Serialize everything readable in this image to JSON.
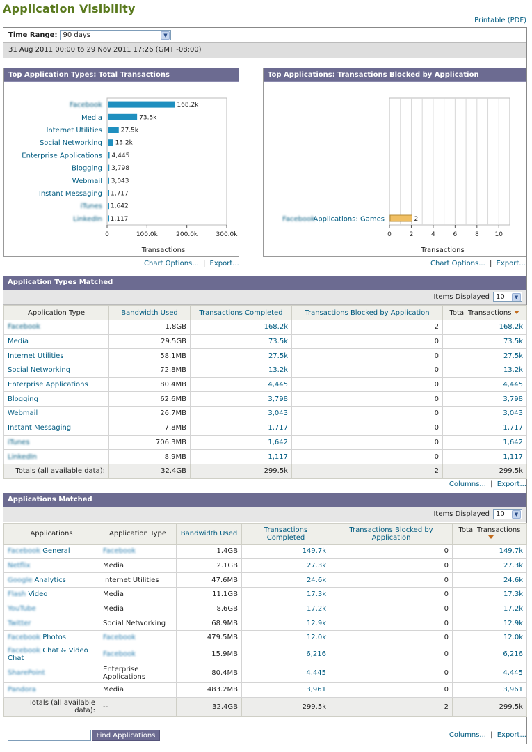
{
  "page": {
    "title": "Application Visibility",
    "printable": "Printable (PDF)"
  },
  "timerange": {
    "label": "Time Range:",
    "value": "90 days",
    "range_text": "31 Aug 2011 00:00 to 29 Nov 2011 17:26 (GMT -08:00)"
  },
  "chart_links": {
    "options": "Chart Options...",
    "sep": "|",
    "export": "Export..."
  },
  "chart_data": [
    {
      "type": "bar",
      "title": "Top Application Types: Total Transactions",
      "xlabel": "Transactions",
      "categories": [
        "Facebook",
        "Media",
        "Internet Utilities",
        "Social Networking",
        "Enterprise Applications",
        "Blogging",
        "Webmail",
        "Instant Messaging",
        "iTunes",
        "LinkedIn"
      ],
      "values": [
        168200,
        73500,
        27500,
        13200,
        4445,
        3798,
        3043,
        1717,
        1642,
        1117
      ],
      "value_labels": [
        "168.2k",
        "73.5k",
        "27.5k",
        "13.2k",
        "4,445",
        "3,798",
        "3,043",
        "1,717",
        "1,642",
        "1,117"
      ],
      "xlim": [
        0,
        300000
      ],
      "ticks": [
        0,
        100000,
        200000,
        300000
      ],
      "tick_labels": [
        "0",
        "100.0k",
        "200.0k",
        "300.0k"
      ],
      "orientation": "horizontal",
      "bar_color": "#1f8fbf",
      "grid": false
    },
    {
      "type": "bar",
      "title": "Top Applications: Transactions Blocked by Application",
      "xlabel": "Transactions",
      "categories": [
        "Facebook Applications: Games"
      ],
      "category_prefix": "Facebook",
      "category_suffix": "Applications: Games",
      "values": [
        2
      ],
      "value_labels": [
        "2"
      ],
      "xlim": [
        0,
        11
      ],
      "ticks": [
        0,
        2,
        4,
        6,
        8,
        10
      ],
      "tick_labels": [
        "0",
        "2",
        "4",
        "6",
        "8",
        "10"
      ],
      "orientation": "horizontal",
      "bar_color": "#f0bf63",
      "grid": true
    }
  ],
  "types_section": {
    "title": "Application Types Matched",
    "items_label": "Items Displayed",
    "items_value": "10",
    "columns": [
      "Application Type",
      "Bandwidth Used",
      "Transactions Completed",
      "Transactions Blocked by Application",
      "Total Transactions"
    ],
    "rows": [
      [
        "Facebook",
        "1.8GB",
        "168.2k",
        "2",
        "168.2k"
      ],
      [
        "Media",
        "29.5GB",
        "73.5k",
        "0",
        "73.5k"
      ],
      [
        "Internet Utilities",
        "58.1MB",
        "27.5k",
        "0",
        "27.5k"
      ],
      [
        "Social Networking",
        "72.8MB",
        "13.2k",
        "0",
        "13.2k"
      ],
      [
        "Enterprise Applications",
        "80.4MB",
        "4,445",
        "0",
        "4,445"
      ],
      [
        "Blogging",
        "62.6MB",
        "3,798",
        "0",
        "3,798"
      ],
      [
        "Webmail",
        "26.7MB",
        "3,043",
        "0",
        "3,043"
      ],
      [
        "Instant Messaging",
        "7.8MB",
        "1,717",
        "0",
        "1,717"
      ],
      [
        "iTunes",
        "706.3MB",
        "1,642",
        "0",
        "1,642"
      ],
      [
        "LinkedIn",
        "8.9MB",
        "1,117",
        "0",
        "1,117"
      ]
    ],
    "totals": [
      "Totals (all available data):",
      "32.4GB",
      "299.5k",
      "2",
      "299.5k"
    ],
    "links": {
      "columns": "Columns...",
      "sep": "|",
      "export": "Export..."
    }
  },
  "apps_section": {
    "title": "Applications Matched",
    "items_label": "Items Displayed",
    "items_value": "10",
    "columns": [
      "Applications",
      "Application Type",
      "Bandwidth Used",
      "Transactions Completed",
      "Transactions Blocked by Application",
      "Total Transactions"
    ],
    "rows": [
      {
        "pre": "Facebook",
        "name": "General",
        "type": "Facebook",
        "type_blur": true,
        "bw": "1.4GB",
        "tc": "149.7k",
        "tb": "0",
        "tt": "149.7k"
      },
      {
        "pre": "Netflix",
        "name": "",
        "type": "Media",
        "type_blur": false,
        "bw": "2.1GB",
        "tc": "27.3k",
        "tb": "0",
        "tt": "27.3k"
      },
      {
        "pre": "Google",
        "name": "Analytics",
        "type": "Internet Utilities",
        "type_blur": false,
        "bw": "47.6MB",
        "tc": "24.6k",
        "tb": "0",
        "tt": "24.6k"
      },
      {
        "pre": "Flash",
        "name": "Video",
        "type": "Media",
        "type_blur": false,
        "bw": "11.1GB",
        "tc": "17.3k",
        "tb": "0",
        "tt": "17.3k"
      },
      {
        "pre": "YouTube",
        "name": "",
        "type": "Media",
        "type_blur": false,
        "bw": "8.6GB",
        "tc": "17.2k",
        "tb": "0",
        "tt": "17.2k"
      },
      {
        "pre": "Twitter",
        "name": "",
        "type": "Social Networking",
        "type_blur": false,
        "bw": "68.9MB",
        "tc": "12.9k",
        "tb": "0",
        "tt": "12.9k"
      },
      {
        "pre": "Facebook",
        "name": "Photos",
        "type": "Facebook",
        "type_blur": true,
        "bw": "479.5MB",
        "tc": "12.0k",
        "tb": "0",
        "tt": "12.0k"
      },
      {
        "pre": "Facebook",
        "name": "Chat & Video Chat",
        "type": "Facebook",
        "type_blur": true,
        "bw": "15.9MB",
        "tc": "6,216",
        "tb": "0",
        "tt": "6,216"
      },
      {
        "pre": "SharePoint",
        "name": "",
        "type": "Enterprise Applications",
        "type_blur": false,
        "bw": "80.4MB",
        "tc": "4,445",
        "tb": "0",
        "tt": "4,445"
      },
      {
        "pre": "Pandora",
        "name": "",
        "type": "Media",
        "type_blur": false,
        "bw": "483.2MB",
        "tc": "3,961",
        "tb": "0",
        "tt": "3,961"
      }
    ],
    "totals": [
      "Totals (all available data):",
      "--",
      "32.4GB",
      "299.5k",
      "2",
      "299.5k"
    ],
    "find_button": "Find Applications",
    "find_value": "",
    "links": {
      "columns": "Columns...",
      "sep": "|",
      "export": "Export..."
    }
  }
}
